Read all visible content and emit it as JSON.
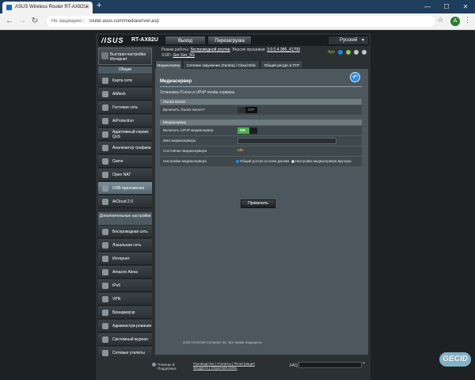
{
  "browser": {
    "tab_title": "ASUS Wireless Router RT-AX82U",
    "new_tab_glyph": "+",
    "insecure_label": "Не защищено",
    "url": "router.asus.com/mediaserver.asp",
    "profile_initial": "A"
  },
  "router": {
    "logo": "/ISUS",
    "model": "RT-AX82U",
    "logout": "Выход",
    "reboot": "Перезагрузка",
    "language": "Русский",
    "info_line1_label": "Режим работы:",
    "info_line1_value": "беспроводной роутер",
    "info_line1_label2": "Версия прошивки:",
    "info_line1_value2": "3.0.0.4.386_41700",
    "info_line2_label": "SSID:",
    "info_line2_value": "Ger  Ger_5G",
    "app_label": "App"
  },
  "sidebar": {
    "qis_label": "Быстрая настройка Интернет",
    "general_header": "Общие",
    "general_items": [
      "Карта сети",
      "AiMesh",
      "Гостевая сеть",
      "AiProtection",
      "Адаптивный сервис QoS",
      "Анализатор трафика",
      "Game",
      "Open NAT",
      "USB-приложение",
      "AiCloud 2.0"
    ],
    "advanced_header": "Дополнительные настройки",
    "advanced_items": [
      "Беспроводная сеть",
      "Локальная сеть",
      "Интернет",
      "Amazon Alexa",
      "IPv6",
      "VPN",
      "Брандмауэр",
      "Администри-рование",
      "Системный журнал",
      "Сетевые утилиты"
    ]
  },
  "tabs": [
    "Медиасервер",
    "Сетевое окружение (Samba) / Cloud Disk",
    "Общий ресурс в FTP"
  ],
  "panel": {
    "title": "Медиасервер",
    "description": "Установка iTunes и UPnP media сервера.",
    "itunes_header": "iTunes Server",
    "itunes_label": "Включить iTunes Server?",
    "itunes_toggle": "OFF",
    "media_header": "Медиасервер",
    "upnp_label": "Включить UPnP медиасервер",
    "upnp_toggle": "ON",
    "name_label": "Имя медиасервера",
    "status_label": "Состояние медиасервера",
    "status_value": "Idle",
    "config_label": "Настройки медиасервера",
    "radio_shared": "Общий доступ ко всем дискам",
    "radio_manual": "Настройка медиасервера вручную",
    "apply": "Применить"
  },
  "footer": {
    "help": "Помощь & Поддержка",
    "links_line1": "Руководство | Утилиты | Регистрация",
    "links_line2": "продукта | Обратная связь",
    "faq": "FAQ",
    "copyright": "2020 ASUSTeK Computer Inc. Все права защищены."
  },
  "watermark": "GECID"
}
